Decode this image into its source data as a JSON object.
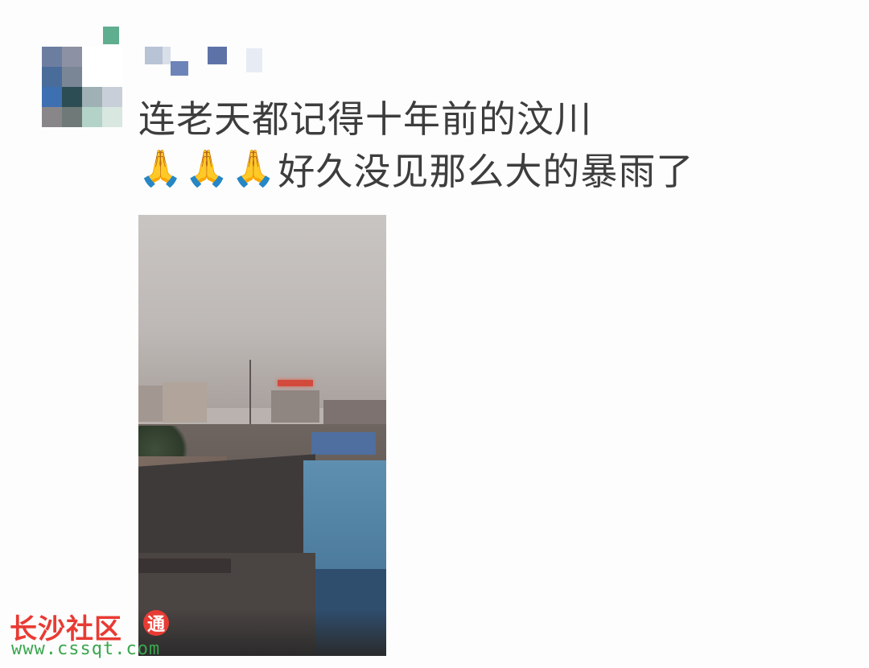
{
  "post": {
    "line1": "连老天都记得十年前的汶川",
    "line2_icons": [
      "folded-hands-icon",
      "folded-hands-icon",
      "folded-hands-icon"
    ],
    "line2_glyph": "🙏",
    "line2_text": "好久没见那么大的暴雨了"
  },
  "watermark": {
    "name": "长沙社区",
    "logo_char": "通",
    "url": "www.cssqt.com"
  }
}
